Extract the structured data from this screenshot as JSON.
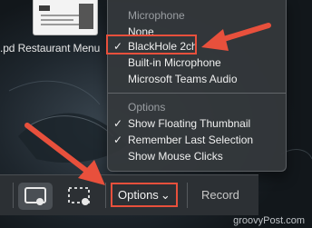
{
  "background": {
    "file_label": ".pd Restaurant Menu"
  },
  "menu": {
    "microphone_header": "Microphone",
    "microphone_items": [
      {
        "label": "None",
        "checked": false
      },
      {
        "label": "BlackHole 2ch",
        "checked": true
      },
      {
        "label": "Built-in Microphone",
        "checked": false
      },
      {
        "label": "Microsoft Teams Audio",
        "checked": false
      }
    ],
    "options_header": "Options",
    "option_items": [
      {
        "label": "Show Floating Thumbnail",
        "checked": true
      },
      {
        "label": "Remember Last Selection",
        "checked": true
      },
      {
        "label": "Show Mouse Clicks",
        "checked": false
      }
    ],
    "check_glyph": "✓"
  },
  "toolbar": {
    "options_label": "Options",
    "options_chevron": "⌄",
    "record_label": "Record",
    "icons": [
      "capture-window-icon",
      "capture-selection-icon"
    ]
  },
  "annotations": {
    "highlight_color": "#e8503c"
  },
  "watermark": "groovyPost.com"
}
